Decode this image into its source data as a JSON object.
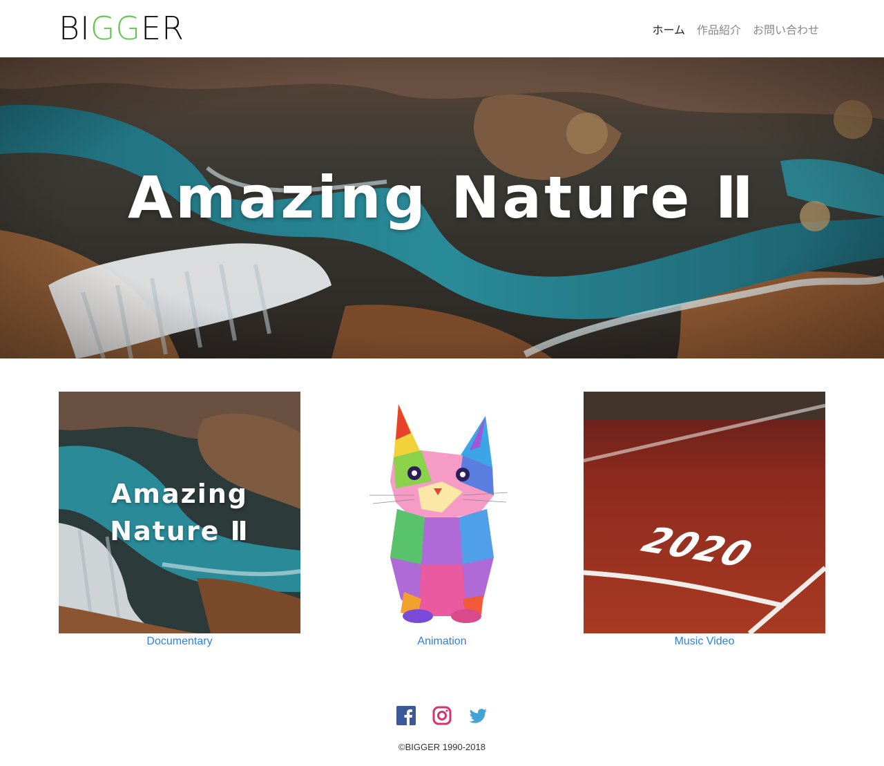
{
  "header": {
    "logo": {
      "letters": [
        "B",
        "I",
        "G",
        "G",
        "E",
        "R"
      ],
      "accent_color": "#5fc84a"
    },
    "nav": [
      {
        "label": "ホーム",
        "active": true
      },
      {
        "label": "作品紹介",
        "active": false
      },
      {
        "label": "お問い合わせ",
        "active": false
      }
    ]
  },
  "hero": {
    "title": "Amazing Nature Ⅱ"
  },
  "works": [
    {
      "caption": "Documentary",
      "thumb_title_line1": "Amazing",
      "thumb_title_line2": "Nature Ⅱ"
    },
    {
      "caption": "Animation"
    },
    {
      "caption": "Music Video",
      "thumb_text": "2020"
    }
  ],
  "footer": {
    "social": [
      {
        "icon": "facebook-icon",
        "color": "#3b5998"
      },
      {
        "icon": "instagram-icon",
        "color": "#d6336c"
      },
      {
        "icon": "twitter-icon",
        "color": "#1da1f2"
      }
    ],
    "copyright": "©BIGGER 1990-2018"
  },
  "colors": {
    "link": "#2f7fe0",
    "nav_active": "#222222",
    "nav_inactive": "#888888"
  }
}
